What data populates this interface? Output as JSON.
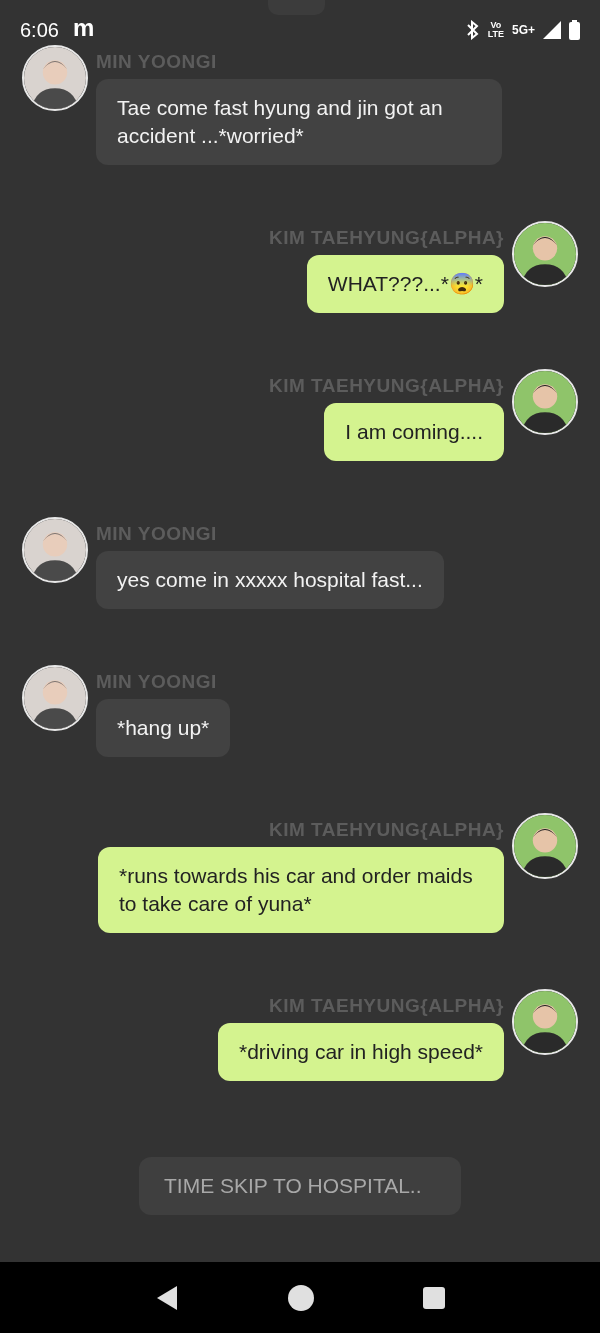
{
  "status_bar": {
    "time": "6:06",
    "app_letter": "m",
    "volte_top": "Vo",
    "volte_bottom": "LTE",
    "network": "5G+"
  },
  "messages": [
    {
      "kind": "received",
      "name": "MIN YOONGI",
      "text": "Tae come fast hyung and jin got an accident ...*worried*"
    },
    {
      "kind": "sent",
      "name": "KIM TAEHYUNG{ALPHA}",
      "text": "WHAT???...*😨*"
    },
    {
      "kind": "sent",
      "name": "KIM TAEHYUNG{ALPHA}",
      "text": "I am coming...."
    },
    {
      "kind": "received",
      "name": "MIN YOONGI",
      "text": "yes come in xxxxx hospital fast..."
    },
    {
      "kind": "received",
      "name": "MIN YOONGI",
      "text": "*hang up*"
    },
    {
      "kind": "sent",
      "name": "KIM TAEHYUNG{ALPHA}",
      "text": "*runs towards his car and order maids to take care of yuna*"
    },
    {
      "kind": "sent",
      "name": "KIM TAEHYUNG{ALPHA}",
      "text": "*driving car in high speed*"
    },
    {
      "kind": "narration",
      "text": "TIME SKIP TO HOSPITAL.."
    }
  ]
}
